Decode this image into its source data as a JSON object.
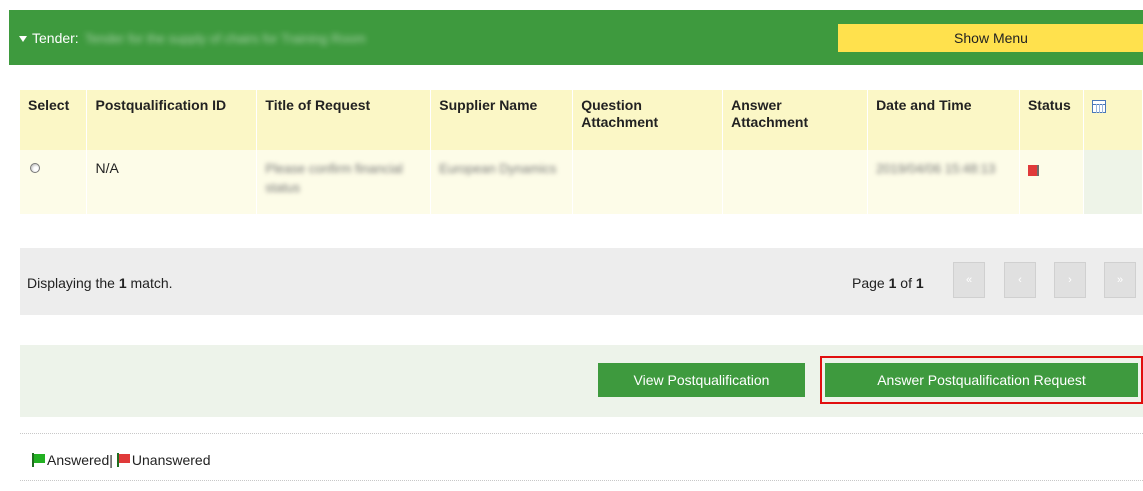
{
  "tender": {
    "label": "Tender:",
    "name": "Tender for the supply of chairs for Training Room"
  },
  "header": {
    "show_menu_label": "Show Menu"
  },
  "table": {
    "columns": [
      "Select",
      "Postqualification ID",
      "Title of Request",
      "Supplier Name",
      "Question Attachment",
      "Answer Attachment",
      "Date and Time",
      "Status"
    ],
    "rows": [
      {
        "postqualification_id": "N/A",
        "title_of_request": "Please confirm financial status",
        "supplier_name": "European Dynamics",
        "question_attachment": "",
        "answer_attachment": "",
        "date_time": "2019/04/06 15:48:13",
        "status": "unanswered"
      }
    ]
  },
  "pager": {
    "display_prefix": "Displaying the",
    "match_count": "1",
    "display_suffix": "match.",
    "page_prefix": "Page",
    "current_page": "1",
    "page_of": "of",
    "total_pages": "1",
    "first": "«",
    "prev": "‹",
    "next": "›",
    "last": "»"
  },
  "actions": {
    "view_label": "View Postqualification",
    "answer_label": "Answer Postqualification Request"
  },
  "legend": {
    "answered": "Answered|",
    "unanswered": "Unanswered"
  },
  "colors": {
    "brand_green": "#3e9a3e",
    "accent_yellow": "#ffe14d",
    "highlight_red": "#e10f0f",
    "flag_red": "#e03a3a"
  },
  "icons": [
    "chevron-down-icon",
    "columns-icon",
    "red-flag-icon",
    "green-flag-icon"
  ]
}
